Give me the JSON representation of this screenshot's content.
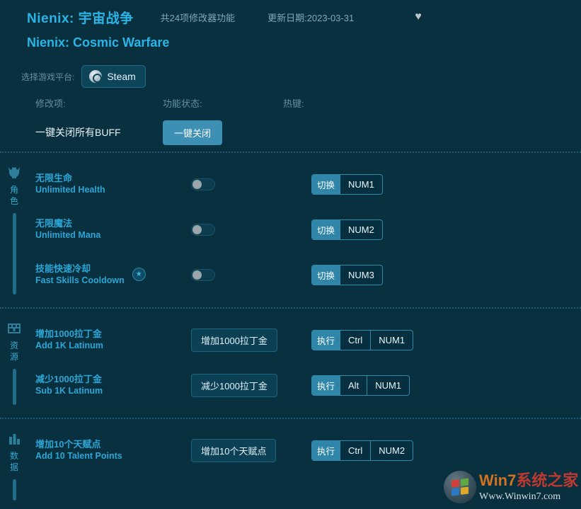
{
  "header": {
    "title_cn": "Nienix: 宇宙战争",
    "title_en": "Nienix: Cosmic Warfare",
    "feature_count": "共24项修改器功能",
    "update_date": "更新日期:2023-03-31",
    "favorite_icon": "♥"
  },
  "platform": {
    "label": "选择游戏平台:",
    "selected": "Steam",
    "icon": "steam-icon"
  },
  "columns": {
    "name": "修改项:",
    "status": "功能状态:",
    "hotkey": "热键:"
  },
  "top_action": {
    "name": "一键关闭所有BUFF",
    "button": "一键关闭"
  },
  "sections": [
    {
      "label": "角色",
      "icon": "helmet-icon",
      "rows": [
        {
          "name_cn": "无限生命",
          "name_en": "Unlimited Health",
          "starred": false,
          "control": "toggle",
          "toggle_state": "off",
          "hotkey_type": "切换",
          "hotkey_keys": [
            "NUM1"
          ]
        },
        {
          "name_cn": "无限魔法",
          "name_en": "Unlimited Mana",
          "starred": false,
          "control": "toggle",
          "toggle_state": "off",
          "hotkey_type": "切换",
          "hotkey_keys": [
            "NUM2"
          ]
        },
        {
          "name_cn": "技能快速冷却",
          "name_en": "Fast Skills Cooldown",
          "starred": true,
          "star_glyph": "★",
          "control": "toggle",
          "toggle_state": "off",
          "hotkey_type": "切换",
          "hotkey_keys": [
            "NUM3"
          ]
        }
      ]
    },
    {
      "label": "资源",
      "icon": "chest-icon",
      "rows": [
        {
          "name_cn": "增加1000拉丁金",
          "name_en": "Add 1K Latinum",
          "starred": false,
          "control": "button",
          "button_label": "增加1000拉丁金",
          "hotkey_type": "执行",
          "hotkey_keys": [
            "Ctrl",
            "NUM1"
          ]
        },
        {
          "name_cn": "减少1000拉丁金",
          "name_en": "Sub 1K Latinum",
          "starred": false,
          "control": "button",
          "button_label": "减少1000拉丁金",
          "hotkey_type": "执行",
          "hotkey_keys": [
            "Alt",
            "NUM1"
          ]
        }
      ]
    },
    {
      "label": "数据",
      "icon": "bar-chart-icon",
      "rows": [
        {
          "name_cn": "增加10个天赋点",
          "name_en": "Add 10 Talent Points",
          "starred": false,
          "control": "button",
          "button_label": "增加10个天赋点",
          "hotkey_type": "执行",
          "hotkey_keys": [
            "Ctrl",
            "NUM2"
          ]
        }
      ]
    }
  ],
  "watermark": {
    "brand_w": "Win",
    "brand_7": "7",
    "brand_cn": "系统之家",
    "url": "Www.Winwin7.com"
  },
  "colors": {
    "background": "#08303f",
    "accent_cyan": "#29b5e8",
    "accent_teal": "#2f86a9",
    "muted": "#67909f"
  }
}
